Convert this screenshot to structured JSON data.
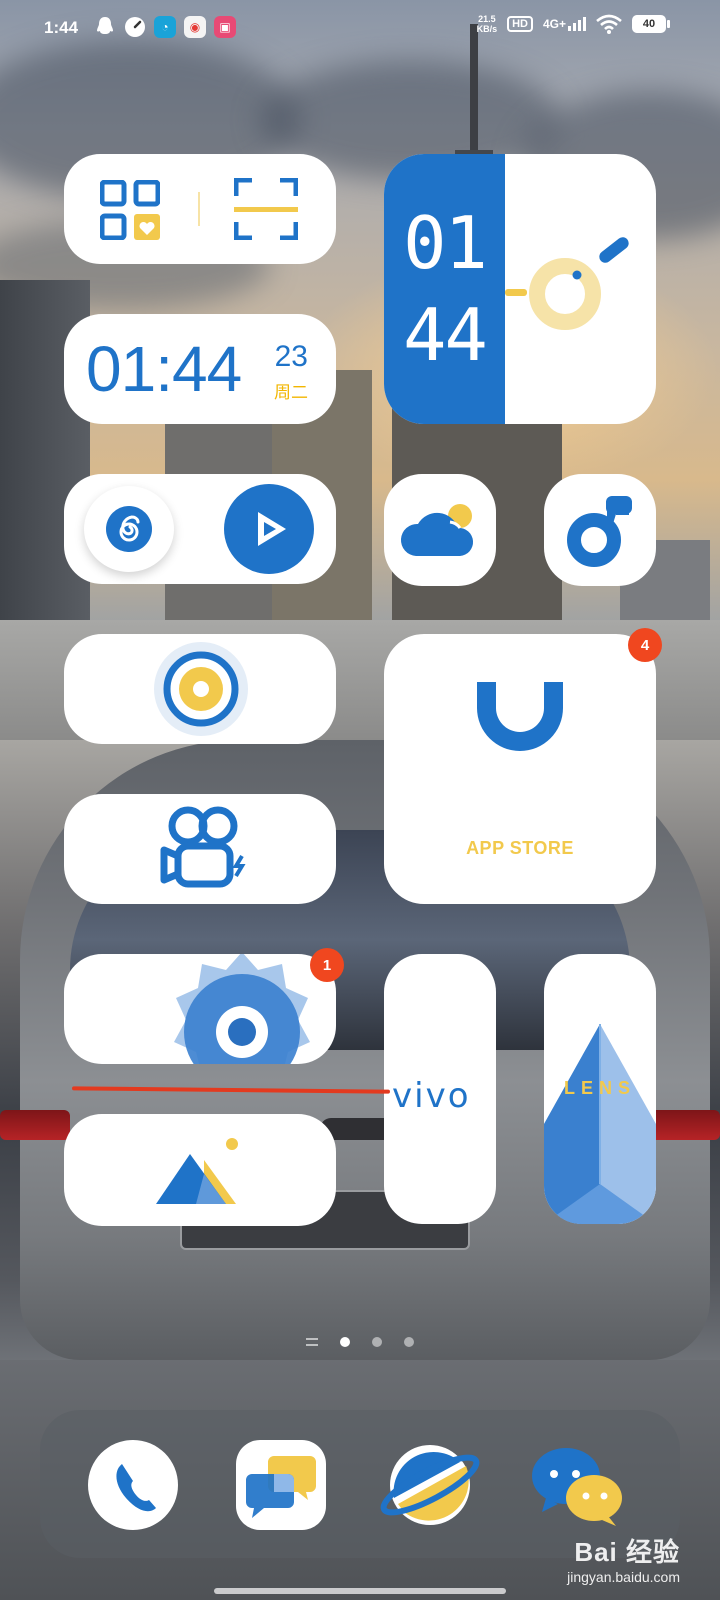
{
  "status_bar": {
    "time": "1:44",
    "net_speed_value": "21.5",
    "net_speed_unit": "KB/s",
    "hd_label": "HD",
    "network_type": "4G+",
    "battery_level": "40"
  },
  "widgets": {
    "big_clock": {
      "hour": "01",
      "minute": "44"
    },
    "small_clock": {
      "time": "01:44",
      "day": "23",
      "weekday": "周二"
    },
    "app_store": {
      "label": "APP STORE",
      "badge": "4"
    },
    "settings": {
      "badge": "1"
    },
    "vivo_tile": {
      "label": "vivo"
    },
    "lens_tile": {
      "label": "LENS"
    }
  },
  "page_indicator": {
    "pages": 3,
    "current": 1
  },
  "watermark": {
    "brand": "Bai 经验",
    "url": "jingyan.baidu.com"
  },
  "colors": {
    "accent": "#1f73c8",
    "accent_yellow": "#f2c94c",
    "badge": "#f0471f"
  }
}
